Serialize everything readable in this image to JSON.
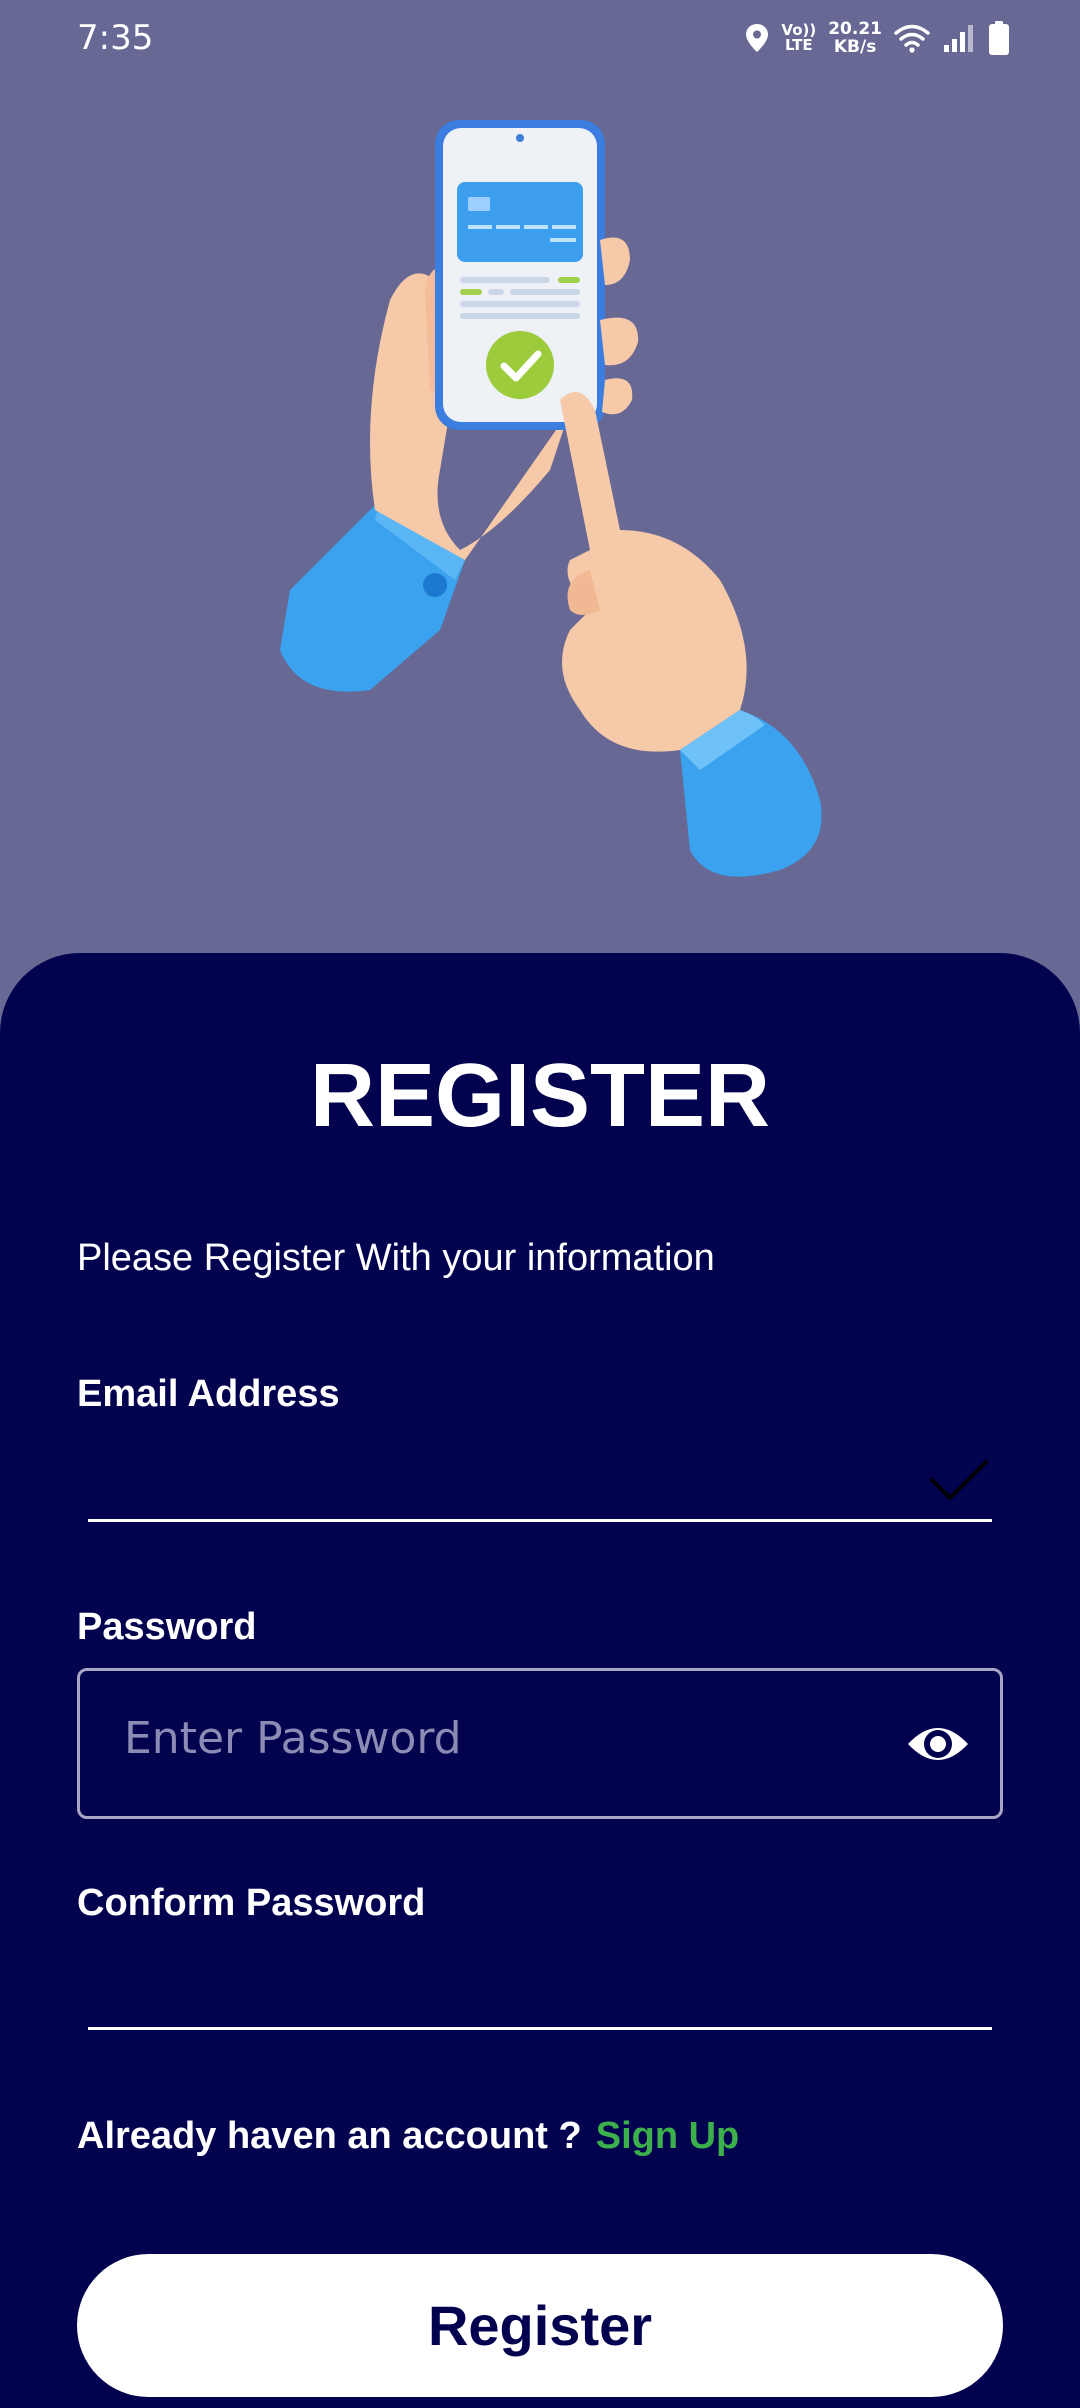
{
  "status_bar": {
    "time": "7:35",
    "network_line1": "Vo))",
    "network_line2": "LTE",
    "speed_value": "20.21",
    "speed_unit": "KB/s",
    "icons": [
      "location-icon",
      "volte-icon",
      "wifi-icon",
      "signal-icon",
      "battery-icon"
    ]
  },
  "illustration": {
    "name": "hands-holding-phone-payment-illustration"
  },
  "form": {
    "title": "REGISTER",
    "subtitle": "Please Register With your information",
    "email_label": "Email Address",
    "email_value": "",
    "password_label": "Password",
    "password_placeholder": "Enter Password",
    "confirm_label": "Conform Password",
    "confirm_value": "",
    "account_prompt": "Already haven an account ?",
    "signup_link": "Sign Up",
    "register_button": "Register"
  },
  "colors": {
    "background": "#686895",
    "card": "#02024f",
    "accent_link": "#3cb04b",
    "button_bg": "#ffffff",
    "button_text": "#02024f"
  }
}
